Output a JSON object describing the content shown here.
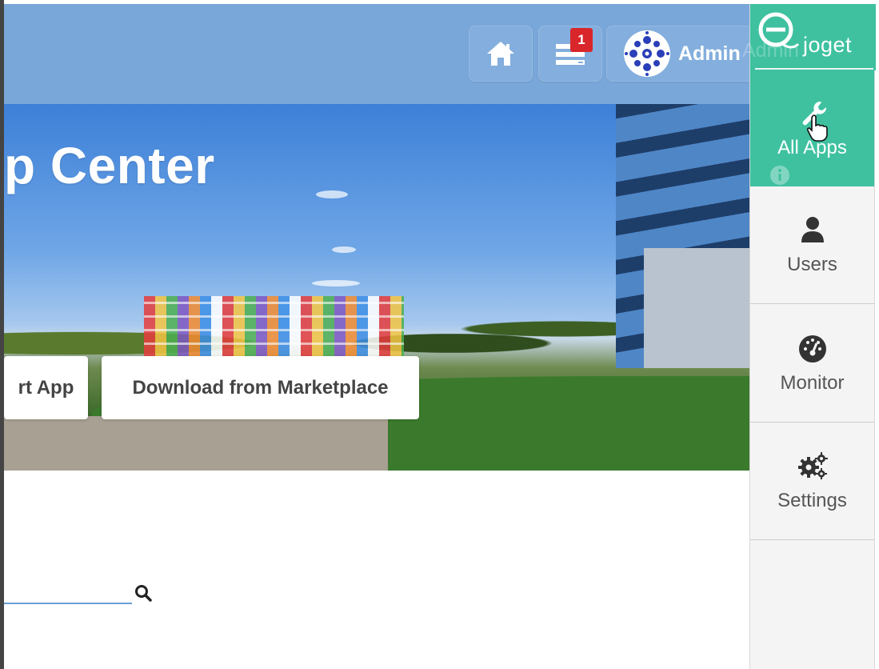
{
  "header": {
    "notification_count": "1",
    "user_name": "Admin"
  },
  "banner": {
    "title": "p Center",
    "import_label": "rt App",
    "download_label": "Download from Marketplace"
  },
  "search": {
    "placeholder": ""
  },
  "sidebar": {
    "brand": "joget",
    "items": [
      {
        "label": "All Apps",
        "icon": "wrench-icon",
        "active": true
      },
      {
        "label": "Users",
        "icon": "user-icon",
        "active": false
      },
      {
        "label": "Monitor",
        "icon": "dashboard-icon",
        "active": false
      },
      {
        "label": "Settings",
        "icon": "gears-icon",
        "active": false
      }
    ]
  },
  "colors": {
    "header": "#7aa7d9",
    "sidebar_accent": "#3fc1a0",
    "badge": "#d9262b"
  }
}
